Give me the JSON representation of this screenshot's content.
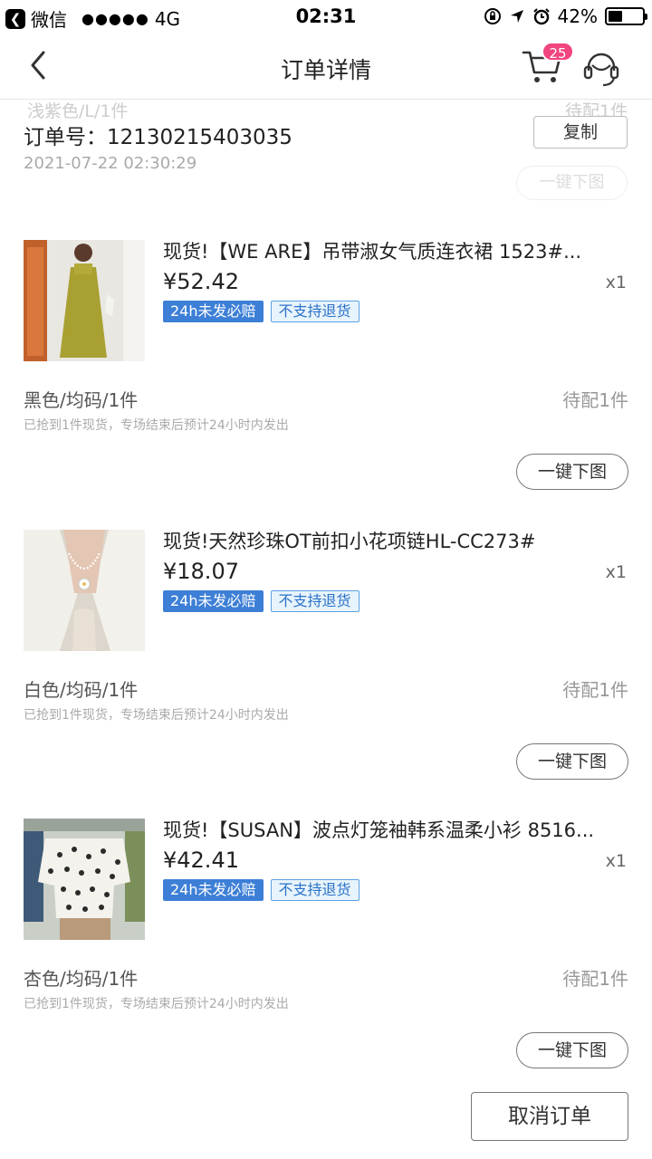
{
  "status_bar": {
    "back_app": "微信",
    "signal": "●●●●●",
    "network": "4G",
    "time": "02:31",
    "battery": "42%",
    "battery_level": 0.42
  },
  "nav": {
    "title": "订单详情",
    "cart_count": "25"
  },
  "order": {
    "ghost_spec": "浅紫色/L/1件",
    "ghost_status": "待配1件",
    "number": "订单号：12130215403035",
    "time": "2021-07-22 02:30:29",
    "copy_label": "复制",
    "ghost_btn": "一键下图"
  },
  "items": [
    {
      "title": "现货!【WE ARE】吊带淑女气质连衣裙 1523#...",
      "price": "¥52.42",
      "qty": "x1",
      "tag1": "24h未发必赔",
      "tag2": "不支持退货",
      "spec": "黑色/均码/1件",
      "status": "待配1件",
      "note": "已抢到1件现货，专场结束后预计24小时内发出",
      "button": "一键下图"
    },
    {
      "title": "现货!天然珍珠OT前扣小花项链HL-CC273#",
      "price": "¥18.07",
      "qty": "x1",
      "tag1": "24h未发必赔",
      "tag2": "不支持退货",
      "spec": "白色/均码/1件",
      "status": "待配1件",
      "note": "已抢到1件现货，专场结束后预计24小时内发出",
      "button": "一键下图"
    },
    {
      "title": "现货!【SUSAN】波点灯笼袖韩系温柔小衫 8516...",
      "price": "¥42.41",
      "qty": "x1",
      "tag1": "24h未发必赔",
      "tag2": "不支持退货",
      "spec": "杏色/均码/1件",
      "status": "待配1件",
      "note": "已抢到1件现货，专场结束后预计24小时内发出",
      "button": "一键下图"
    }
  ],
  "footer": {
    "cancel_label": "取消订单"
  },
  "colors": {
    "badge": "#f0457f",
    "tag_blue": "#3d7fd6",
    "tag_outline": "#5aa2e4"
  }
}
